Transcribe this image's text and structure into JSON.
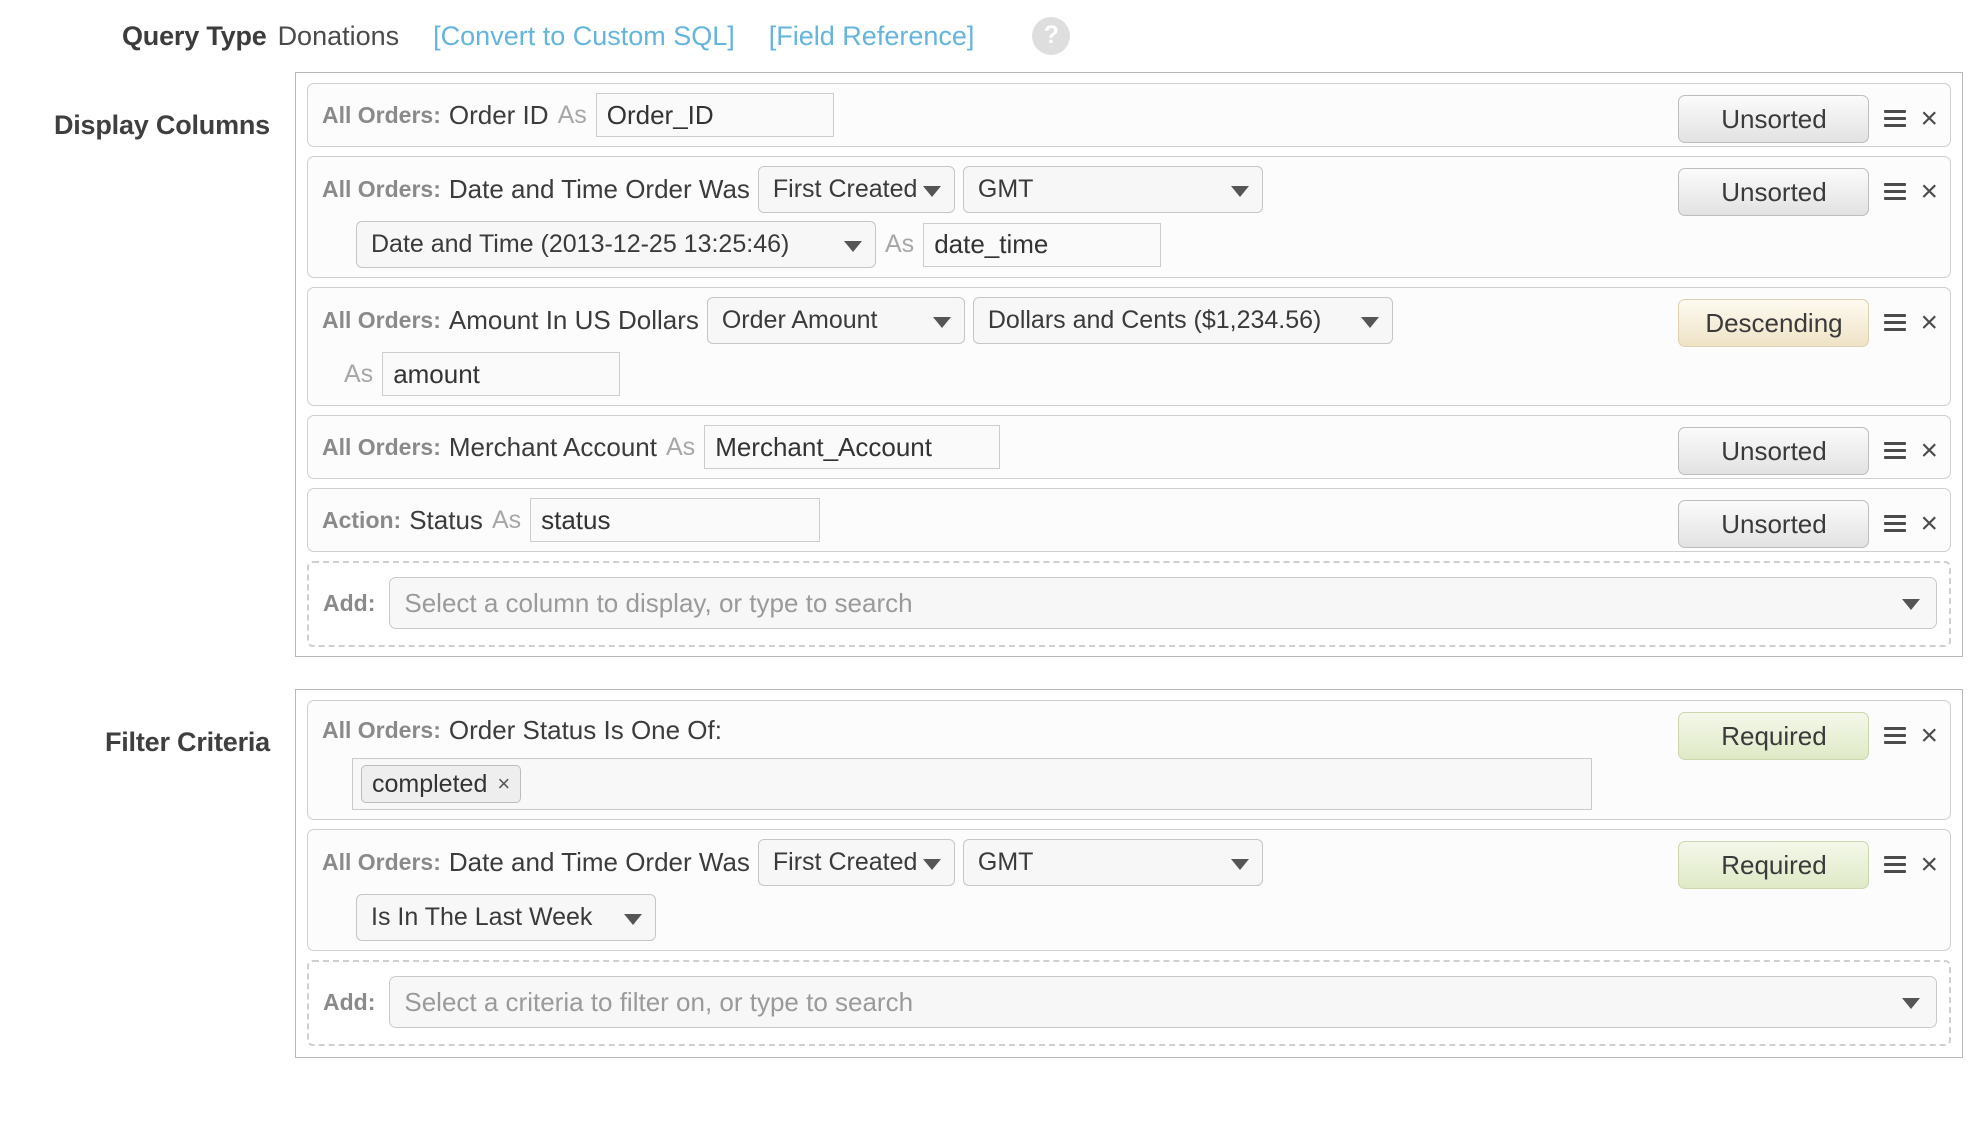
{
  "query_type": {
    "label": "Query Type",
    "value": "Donations",
    "convert_link": "[Convert to Custom SQL]",
    "field_reference_link": "[Field Reference]",
    "help_icon": "question-mark-icon",
    "help_glyph": "?",
    "link_color": "#64b5dc"
  },
  "display_columns": {
    "label": "Display Columns",
    "rows": [
      {
        "source": "All Orders:",
        "field": "Order ID",
        "as_label": "As",
        "alias": "Order_ID",
        "sort": "Unsorted"
      },
      {
        "source": "All Orders:",
        "field": "Date and Time Order Was",
        "created_select": "First Created",
        "timezone_select": "GMT",
        "format_select": "Date and Time (2013-12-25 13:25:46)",
        "as_label": "As",
        "alias": "date_time",
        "sort": "Unsorted"
      },
      {
        "source": "All Orders:",
        "field": "Amount In US Dollars",
        "amount_select": "Order Amount",
        "money_format_select": "Dollars and Cents ($1,234.56)",
        "as_label": "As",
        "alias": "amount",
        "sort": "Descending"
      },
      {
        "source": "All Orders:",
        "field": "Merchant Account",
        "as_label": "As",
        "alias": "Merchant_Account",
        "sort": "Unsorted"
      },
      {
        "source": "Action:",
        "field": "Status",
        "as_label": "As",
        "alias": "status",
        "sort": "Unsorted"
      }
    ],
    "add": {
      "label": "Add:",
      "placeholder": "Select a column to display, or type to search"
    }
  },
  "filter_criteria": {
    "label": "Filter Criteria",
    "rows": [
      {
        "source": "All Orders:",
        "field": "Order Status Is One Of:",
        "tokens": [
          "completed"
        ],
        "token_remove_glyph": "×",
        "requirement": "Required"
      },
      {
        "source": "All Orders:",
        "field": "Date and Time Order Was",
        "created_select": "First Created",
        "timezone_select": "GMT",
        "condition_select": "Is In The Last Week",
        "requirement": "Required"
      }
    ],
    "add": {
      "label": "Add:",
      "placeholder": "Select a criteria to filter on, or type to search"
    }
  },
  "icons": {
    "menu": "hamburger-handle-icon",
    "close": "×",
    "caret": "chevron-down-icon"
  },
  "colors": {
    "descending_accent": "#efe3c6",
    "required_accent": "#dfe9c6",
    "link": "#64b5dc",
    "border": "#cfcfcf"
  }
}
